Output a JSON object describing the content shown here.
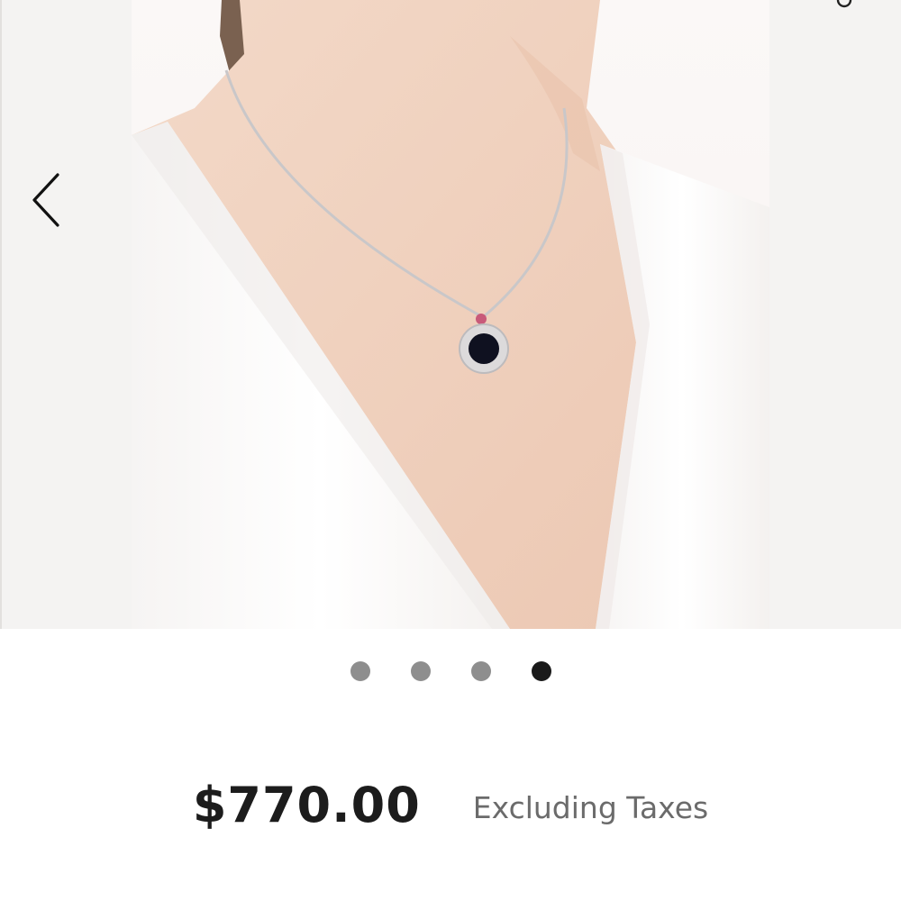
{
  "gallery": {
    "image_description_icon": "necklace-photo",
    "prev_icon": "chevron-left-icon",
    "corner_icon": "partial-icon"
  },
  "pagination": {
    "total": 4,
    "active_index": 3
  },
  "product": {
    "price": "$770.00",
    "tax_note": "Excluding Taxes"
  },
  "colors": {
    "gallery_bg": "#f4f3f2",
    "dot_inactive": "#8e8e8e",
    "dot_active": "#1a1a1a",
    "price_text": "#1c1c1c",
    "tax_text": "#6b6b6b"
  }
}
